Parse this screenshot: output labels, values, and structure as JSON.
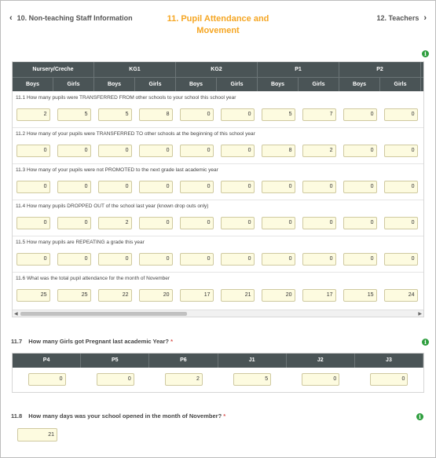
{
  "nav": {
    "prev_label": "10. Non-teaching Staff Information",
    "next_label": "12. Teachers",
    "title_line1": "11. Pupil Attendance and",
    "title_line2": "Movement"
  },
  "table": {
    "groups": [
      "Nursery/Creche",
      "KG1",
      "KG2",
      "P1",
      "P2"
    ],
    "subheaders": [
      "Boys",
      "Girls",
      "Boys",
      "Girls",
      "Boys",
      "Girls",
      "Boys",
      "Girls",
      "Boys",
      "Girls"
    ],
    "questions": [
      {
        "label": "11.1 How many pupils were TRANSFERRED FROM other schools to your school this school year",
        "values": [
          "2",
          "5",
          "5",
          "8",
          "0",
          "0",
          "5",
          "7",
          "0",
          "0"
        ]
      },
      {
        "label": "11.2 How many of your pupils were TRANSFERRED TO other schools at the beginning of this school year",
        "values": [
          "0",
          "0",
          "0",
          "0",
          "0",
          "0",
          "8",
          "2",
          "0",
          "0"
        ]
      },
      {
        "label": "11.3 How many of your pupils were not PROMOTED to the next grade last academic year",
        "values": [
          "0",
          "0",
          "0",
          "0",
          "0",
          "0",
          "0",
          "0",
          "0",
          "0"
        ]
      },
      {
        "label": "11.4 How many pupils DROPPED OUT of the school last year (known drop outs only)",
        "values": [
          "0",
          "0",
          "2",
          "0",
          "0",
          "0",
          "0",
          "0",
          "0",
          "0"
        ]
      },
      {
        "label": "11.5 How many pupils are REPEATING a grade this year",
        "values": [
          "0",
          "0",
          "0",
          "0",
          "0",
          "0",
          "0",
          "0",
          "0",
          "0"
        ]
      },
      {
        "label": "11.6 What was the total pupil attendance for the month of November",
        "values": [
          "25",
          "25",
          "22",
          "20",
          "17",
          "21",
          "20",
          "17",
          "15",
          "24"
        ]
      }
    ]
  },
  "q117": {
    "number": "11.7",
    "label": "How many Girls got Pregnant last academic Year?",
    "required": "*",
    "columns": [
      "P4",
      "P5",
      "P6",
      "J1",
      "J2",
      "J3"
    ],
    "values": [
      "0",
      "0",
      "2",
      "5",
      "0",
      "0"
    ]
  },
  "q118": {
    "number": "11.8",
    "label": "How many days was your school opened in the month of November?",
    "required": "*",
    "value": "21"
  },
  "icons": {
    "info": "i",
    "prev": "‹",
    "next": "›",
    "scroll_left": "◀",
    "scroll_right": "▶"
  }
}
